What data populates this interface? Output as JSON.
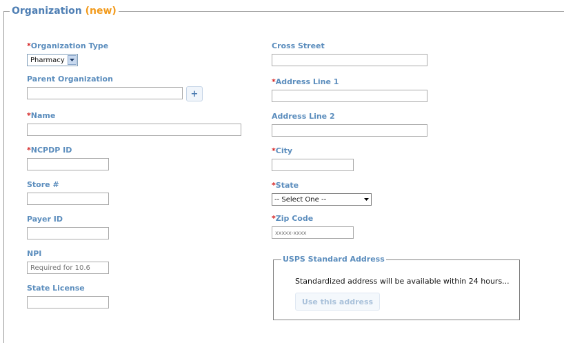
{
  "legend": {
    "title": "Organization",
    "badge": "(new)"
  },
  "required_mark": "*",
  "left": {
    "org_type": {
      "label": "Organization Type",
      "value": "Pharmacy"
    },
    "parent_org": {
      "label": "Parent Organization",
      "value": "",
      "add_button": "+"
    },
    "name": {
      "label": "Name",
      "value": ""
    },
    "ncpdp": {
      "label": "NCPDP ID",
      "value": ""
    },
    "store": {
      "label": "Store #",
      "value": ""
    },
    "payer": {
      "label": "Payer ID",
      "value": ""
    },
    "npi": {
      "label": "NPI",
      "placeholder": "Required for 10.6"
    },
    "state_license": {
      "label": "State License",
      "value": ""
    }
  },
  "right": {
    "cross_street": {
      "label": "Cross Street",
      "value": ""
    },
    "address1": {
      "label": "Address Line 1",
      "value": ""
    },
    "address2": {
      "label": "Address Line 2",
      "value": ""
    },
    "city": {
      "label": "City",
      "value": ""
    },
    "state": {
      "label": "State",
      "value": "-- Select One --"
    },
    "zip": {
      "label": "Zip Code",
      "placeholder": "xxxxx-xxxx"
    }
  },
  "usps": {
    "title": "USPS Standard Address",
    "message": "Standardized address will be available within 24 hours...",
    "button": "Use this address"
  },
  "colors": {
    "label": "#5b8dbd",
    "required": "#d42222",
    "badge": "#f29a1b",
    "title": "#4f7fb4"
  }
}
